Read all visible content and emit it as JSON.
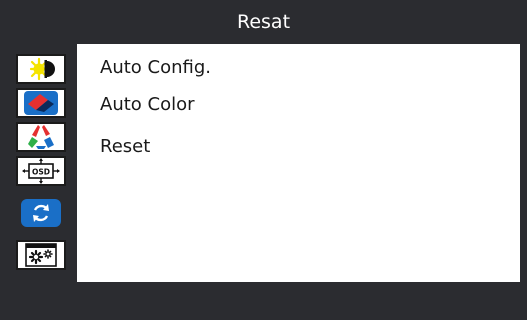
{
  "header": {
    "title": "Resat"
  },
  "sidebar": {
    "items": [
      {
        "icon": "brightness-contrast-icon",
        "selected": false
      },
      {
        "icon": "image-adjust-icon",
        "selected": false
      },
      {
        "icon": "color-icon",
        "selected": false
      },
      {
        "icon": "osd-settings-icon",
        "label": "OSD",
        "selected": false
      },
      {
        "icon": "reset-icon",
        "selected": true
      },
      {
        "icon": "other-settings-icon",
        "selected": false
      }
    ]
  },
  "menu": {
    "items": [
      {
        "label": "Auto Config."
      },
      {
        "label": "Auto Color"
      },
      {
        "label": "Reset"
      }
    ]
  },
  "colors": {
    "background": "#2b2c30",
    "panel": "#ffffff",
    "accent": "#1a6fc7",
    "text": "#1a1a1a"
  }
}
